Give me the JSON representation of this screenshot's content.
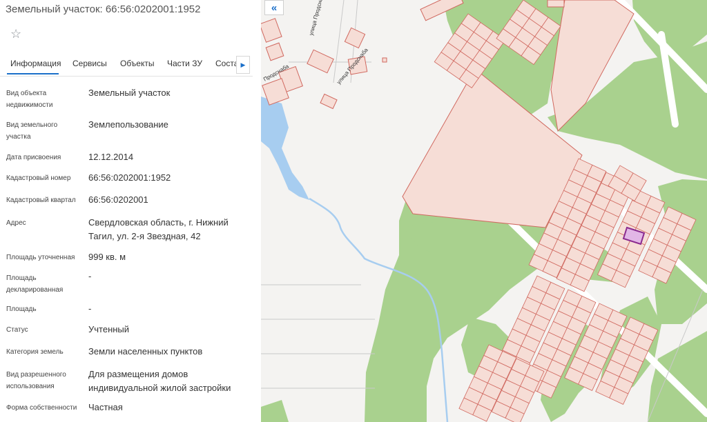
{
  "panel": {
    "title": "Земельный участок: 66:56:0202001:1952",
    "star_icon": "star-icon",
    "tabs": [
      {
        "label": "Информация",
        "active": true
      },
      {
        "label": "Сервисы",
        "active": false
      },
      {
        "label": "Объекты",
        "active": false
      },
      {
        "label": "Части ЗУ",
        "active": false
      },
      {
        "label": "Соста",
        "active": false
      }
    ],
    "tab_scroll_icon": "chevron-right-icon",
    "rows": [
      {
        "label": "Вид объекта недвижимости",
        "value": "Земельный участок"
      },
      {
        "label": "Вид земельного участка",
        "value": "Землепользование"
      },
      {
        "label": "Дата присвоения",
        "value": "12.12.2014"
      },
      {
        "label": "Кадастровый номер",
        "value": "66:56:0202001:1952"
      },
      {
        "label": "Кадастровый квартал",
        "value": "66:56:0202001"
      },
      {
        "label": "Адрес",
        "value": "Свердловская область, г. Нижний Тагил, ул. 2-я Звездная, 42"
      },
      {
        "label": "Площадь уточненная",
        "value": "999 кв. м"
      },
      {
        "label": "Площадь декларированная",
        "value": "-"
      },
      {
        "label": "Площадь",
        "value": "-"
      },
      {
        "label": "Статус",
        "value": "Учтенный"
      },
      {
        "label": "Категория земель",
        "value": "Земли населенных пунктов"
      },
      {
        "label": "Вид разрешенного использования",
        "value": "Для размещения домов индивидуальной жилой застройки"
      },
      {
        "label": "Форма собственности",
        "value": "Частная"
      }
    ]
  },
  "map": {
    "collapse_icon": "double-chevron-left-icon",
    "streets": [
      "улица Продснаба",
      "улица Продснаба",
      "Продснаба"
    ],
    "colors": {
      "background": "#f4f3f1",
      "forest": "#a9d18e",
      "water": "#a7cdf0",
      "parcel_fill": "#f6ddd6",
      "parcel_stroke": "#d0685f",
      "selected_fill": "#e2b6e6",
      "selected_stroke": "#8a2a8f"
    }
  }
}
